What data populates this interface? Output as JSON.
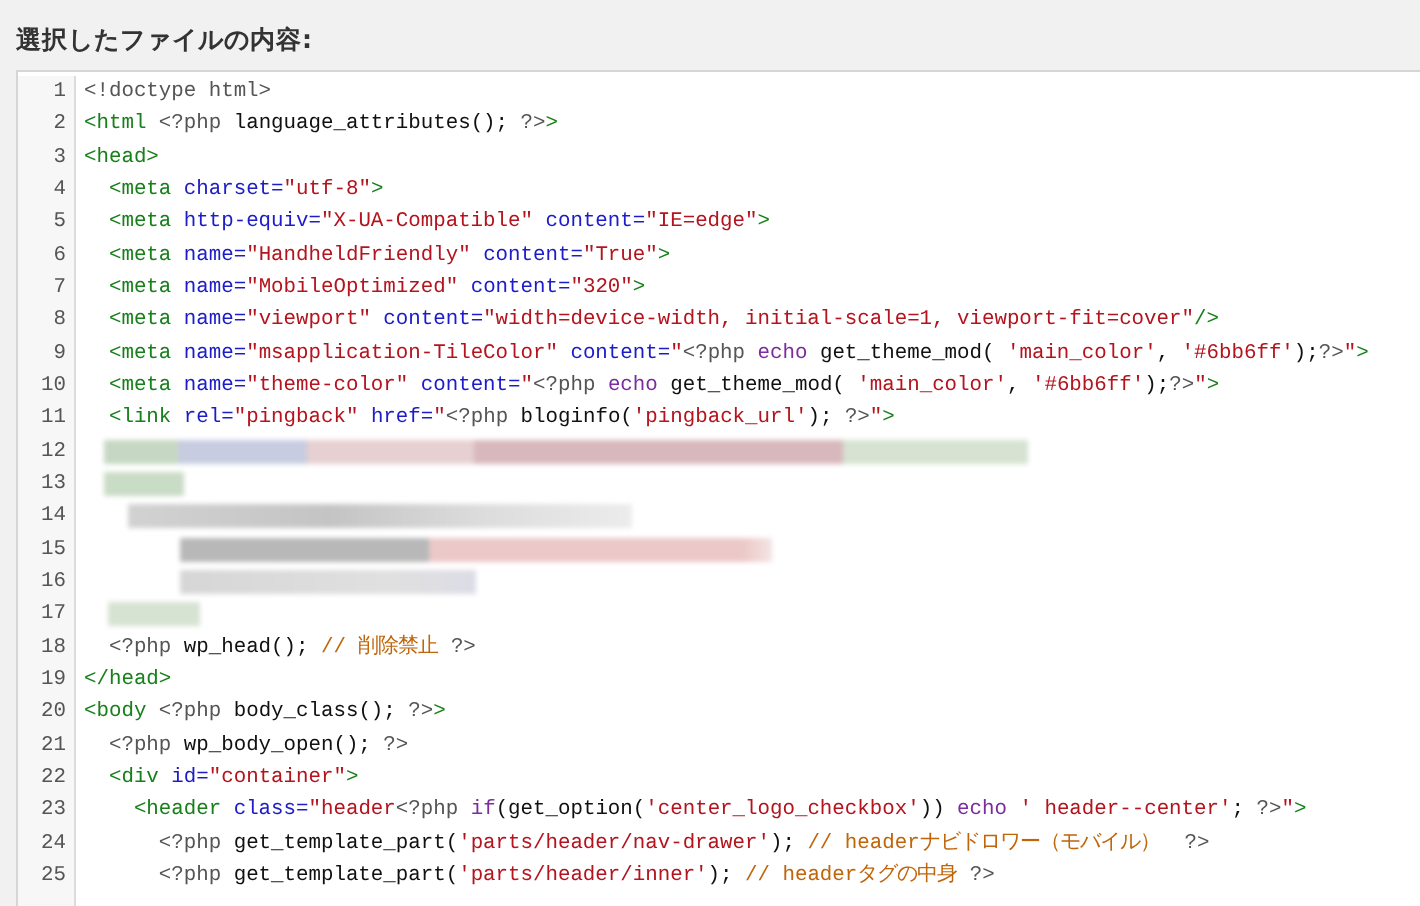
{
  "heading": "選択したファイルの内容:",
  "editor": {
    "lines": [
      {
        "number": "1",
        "kind": "code",
        "tokens": [
          {
            "kind": "doctype",
            "text": "<!doctype html>"
          }
        ]
      },
      {
        "number": "2",
        "kind": "code",
        "tokens": [
          {
            "kind": "tag",
            "text": "<html"
          },
          {
            "kind": "php",
            "text": " <?php"
          },
          {
            "kind": "plain",
            "text": " language_attributes();"
          },
          {
            "kind": "php",
            "text": " ?>"
          },
          {
            "kind": "tag",
            "text": ">"
          }
        ]
      },
      {
        "number": "3",
        "kind": "code",
        "tokens": [
          {
            "kind": "tag",
            "text": "<head>"
          }
        ]
      },
      {
        "number": "4",
        "kind": "code",
        "tokens": [
          {
            "kind": "tag",
            "text": "  <meta"
          },
          {
            "kind": "attr",
            "text": " charset="
          },
          {
            "kind": "string",
            "text": "\"utf-8\""
          },
          {
            "kind": "tag",
            "text": ">"
          }
        ]
      },
      {
        "number": "5",
        "kind": "code",
        "tokens": [
          {
            "kind": "tag",
            "text": "  <meta"
          },
          {
            "kind": "attr",
            "text": " http-equiv="
          },
          {
            "kind": "string",
            "text": "\"X-UA-Compatible\""
          },
          {
            "kind": "attr",
            "text": " content="
          },
          {
            "kind": "string",
            "text": "\"IE=edge\""
          },
          {
            "kind": "tag",
            "text": ">"
          }
        ]
      },
      {
        "number": "6",
        "kind": "code",
        "tokens": [
          {
            "kind": "tag",
            "text": "  <meta"
          },
          {
            "kind": "attr",
            "text": " name="
          },
          {
            "kind": "string",
            "text": "\"HandheldFriendly\""
          },
          {
            "kind": "attr",
            "text": " content="
          },
          {
            "kind": "string",
            "text": "\"True\""
          },
          {
            "kind": "tag",
            "text": ">"
          }
        ]
      },
      {
        "number": "7",
        "kind": "code",
        "tokens": [
          {
            "kind": "tag",
            "text": "  <meta"
          },
          {
            "kind": "attr",
            "text": " name="
          },
          {
            "kind": "string",
            "text": "\"MobileOptimized\""
          },
          {
            "kind": "attr",
            "text": " content="
          },
          {
            "kind": "string",
            "text": "\"320\""
          },
          {
            "kind": "tag",
            "text": ">"
          }
        ]
      },
      {
        "number": "8",
        "kind": "code",
        "tokens": [
          {
            "kind": "tag",
            "text": "  <meta"
          },
          {
            "kind": "attr",
            "text": " name="
          },
          {
            "kind": "string",
            "text": "\"viewport\""
          },
          {
            "kind": "attr",
            "text": " content="
          },
          {
            "kind": "string",
            "text": "\"width=device-width, initial-scale=1, viewport-fit=cover\""
          },
          {
            "kind": "tag",
            "text": "/>"
          }
        ]
      },
      {
        "number": "9",
        "kind": "code",
        "tokens": [
          {
            "kind": "tag",
            "text": "  <meta"
          },
          {
            "kind": "attr",
            "text": " name="
          },
          {
            "kind": "string",
            "text": "\"msapplication-TileColor\""
          },
          {
            "kind": "attr",
            "text": " content="
          },
          {
            "kind": "string",
            "text": "\""
          },
          {
            "kind": "php",
            "text": "<?php"
          },
          {
            "kind": "keyword",
            "text": " echo"
          },
          {
            "kind": "plain",
            "text": " get_theme_mod("
          },
          {
            "kind": "string",
            "text": " 'main_color'"
          },
          {
            "kind": "plain",
            "text": ","
          },
          {
            "kind": "string",
            "text": " '#6bb6ff'"
          },
          {
            "kind": "plain",
            "text": ");"
          },
          {
            "kind": "php",
            "text": "?>"
          },
          {
            "kind": "string",
            "text": "\""
          },
          {
            "kind": "tag",
            "text": ">"
          }
        ]
      },
      {
        "number": "10",
        "kind": "code",
        "tokens": [
          {
            "kind": "tag",
            "text": "  <meta"
          },
          {
            "kind": "attr",
            "text": " name="
          },
          {
            "kind": "string",
            "text": "\"theme-color\""
          },
          {
            "kind": "attr",
            "text": " content="
          },
          {
            "kind": "string",
            "text": "\""
          },
          {
            "kind": "php",
            "text": "<?php"
          },
          {
            "kind": "keyword",
            "text": " echo"
          },
          {
            "kind": "plain",
            "text": " get_theme_mod("
          },
          {
            "kind": "string",
            "text": " 'main_color'"
          },
          {
            "kind": "plain",
            "text": ","
          },
          {
            "kind": "string",
            "text": " '#6bb6ff'"
          },
          {
            "kind": "plain",
            "text": ");"
          },
          {
            "kind": "php",
            "text": "?>"
          },
          {
            "kind": "string",
            "text": "\""
          },
          {
            "kind": "tag",
            "text": ">"
          }
        ]
      },
      {
        "number": "11",
        "kind": "code",
        "tokens": [
          {
            "kind": "tag",
            "text": "  <link"
          },
          {
            "kind": "attr",
            "text": " rel="
          },
          {
            "kind": "string",
            "text": "\"pingback\""
          },
          {
            "kind": "attr",
            "text": " href="
          },
          {
            "kind": "string",
            "text": "\""
          },
          {
            "kind": "php",
            "text": "<?php"
          },
          {
            "kind": "plain",
            "text": " bloginfo("
          },
          {
            "kind": "string",
            "text": "'pingback_url'"
          },
          {
            "kind": "plain",
            "text": ");"
          },
          {
            "kind": "php",
            "text": " ?>"
          },
          {
            "kind": "string",
            "text": "\""
          },
          {
            "kind": "tag",
            "text": ">"
          }
        ]
      },
      {
        "number": "12",
        "kind": "redacted"
      },
      {
        "number": "13",
        "kind": "redacted"
      },
      {
        "number": "14",
        "kind": "redacted"
      },
      {
        "number": "15",
        "kind": "redacted"
      },
      {
        "number": "16",
        "kind": "redacted"
      },
      {
        "number": "17",
        "kind": "redacted"
      },
      {
        "number": "18",
        "kind": "code",
        "tokens": [
          {
            "kind": "php",
            "text": "  <?php"
          },
          {
            "kind": "plain",
            "text": " wp_head();"
          },
          {
            "kind": "comment",
            "text": " // 削除禁止"
          },
          {
            "kind": "php",
            "text": " ?>"
          }
        ]
      },
      {
        "number": "19",
        "kind": "code",
        "tokens": [
          {
            "kind": "tag",
            "text": "</head>"
          }
        ]
      },
      {
        "number": "20",
        "kind": "code",
        "tokens": [
          {
            "kind": "tag",
            "text": "<body"
          },
          {
            "kind": "php",
            "text": " <?php"
          },
          {
            "kind": "plain",
            "text": " body_class();"
          },
          {
            "kind": "php",
            "text": " ?>"
          },
          {
            "kind": "tag",
            "text": ">"
          }
        ]
      },
      {
        "number": "21",
        "kind": "code",
        "tokens": [
          {
            "kind": "php",
            "text": "  <?php"
          },
          {
            "kind": "plain",
            "text": " wp_body_open();"
          },
          {
            "kind": "php",
            "text": " ?>"
          }
        ]
      },
      {
        "number": "22",
        "kind": "code",
        "tokens": [
          {
            "kind": "tag",
            "text": "  <div"
          },
          {
            "kind": "attr",
            "text": " id="
          },
          {
            "kind": "string",
            "text": "\"container\""
          },
          {
            "kind": "tag",
            "text": ">"
          }
        ]
      },
      {
        "number": "23",
        "kind": "code",
        "tokens": [
          {
            "kind": "tag",
            "text": "    <header"
          },
          {
            "kind": "attr",
            "text": " class="
          },
          {
            "kind": "string",
            "text": "\"header"
          },
          {
            "kind": "php",
            "text": "<?php"
          },
          {
            "kind": "keyword",
            "text": " if"
          },
          {
            "kind": "plain",
            "text": "(get_option("
          },
          {
            "kind": "string",
            "text": "'center_logo_checkbox'"
          },
          {
            "kind": "plain",
            "text": "))"
          },
          {
            "kind": "keyword",
            "text": " echo"
          },
          {
            "kind": "string",
            "text": " ' header--center'"
          },
          {
            "kind": "plain",
            "text": ";"
          },
          {
            "kind": "php",
            "text": " ?>"
          },
          {
            "kind": "string",
            "text": "\""
          },
          {
            "kind": "tag",
            "text": ">"
          }
        ]
      },
      {
        "number": "24",
        "kind": "code",
        "tokens": [
          {
            "kind": "php",
            "text": "      <?php"
          },
          {
            "kind": "plain",
            "text": " get_template_part("
          },
          {
            "kind": "string",
            "text": "'parts/header/nav-drawer'"
          },
          {
            "kind": "plain",
            "text": ");"
          },
          {
            "kind": "comment",
            "text": " // headerナビドロワー（モバイル）"
          },
          {
            "kind": "php",
            "text": "  ?>"
          }
        ]
      },
      {
        "number": "25",
        "kind": "code",
        "tokens": [
          {
            "kind": "php",
            "text": "      <?php"
          },
          {
            "kind": "plain",
            "text": " get_template_part("
          },
          {
            "kind": "string",
            "text": "'parts/header/inner'"
          },
          {
            "kind": "plain",
            "text": ");"
          },
          {
            "kind": "comment",
            "text": " // headerタグの中身"
          },
          {
            "kind": "php",
            "text": " ?>"
          }
        ]
      }
    ]
  }
}
